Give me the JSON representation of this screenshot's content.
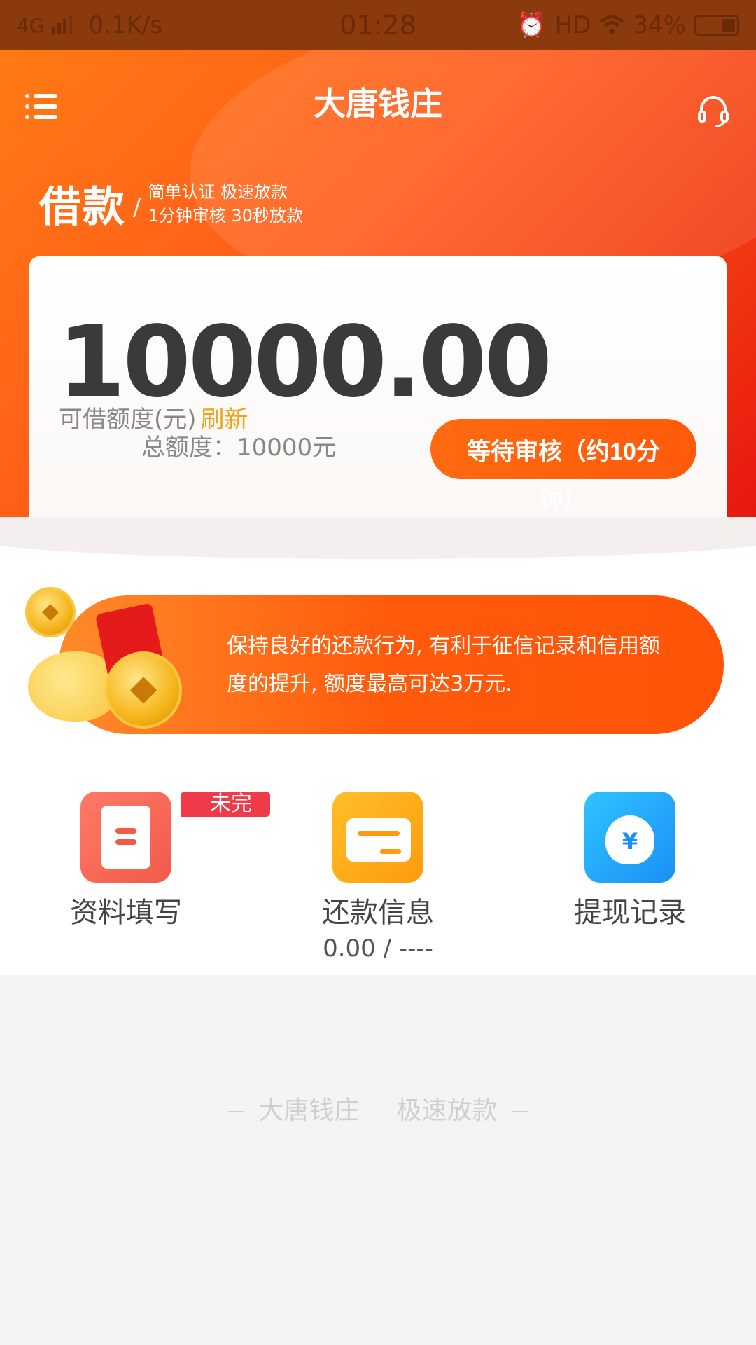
{
  "status_bar": {
    "network": "4G",
    "speed": "0.1K/s",
    "time": "01:28",
    "hd": "HD",
    "battery": "34%"
  },
  "header": {
    "title": "大唐钱庄",
    "menu_icon": "menu-icon",
    "support_icon": "headset-icon"
  },
  "tagline": {
    "big": "借款",
    "slash": "/",
    "line1": "简单认证  极速放款",
    "line2": "1分钟审核  30秒放款"
  },
  "card": {
    "amount": "10000.00",
    "limit_label": "可借额度(元)",
    "refresh": "刷新",
    "total": "总额度：10000元",
    "wait_button": "等待审核（约10分",
    "wait_overflow": "钟）"
  },
  "banner": {
    "text": "保持良好的还款行为, 有利于征信记录和信用额度的提升, 额度最高可达3万元."
  },
  "features": [
    {
      "label": "资料填写",
      "badge": "未完",
      "icon": "document-icon"
    },
    {
      "label": "还款信息",
      "sub": "0.00 / ----",
      "icon": "card-icon"
    },
    {
      "label": "提现记录",
      "icon": "money-bag-icon",
      "glyph": "¥"
    }
  ],
  "footer": {
    "slogan_left": "大唐钱庄",
    "slogan_right": "极速放款"
  },
  "colors": {
    "brand_orange": "#ff5a1a",
    "button_orange": "#ff6a10",
    "refresh": "#f0a21c",
    "badge_red": "#f03a4a"
  }
}
